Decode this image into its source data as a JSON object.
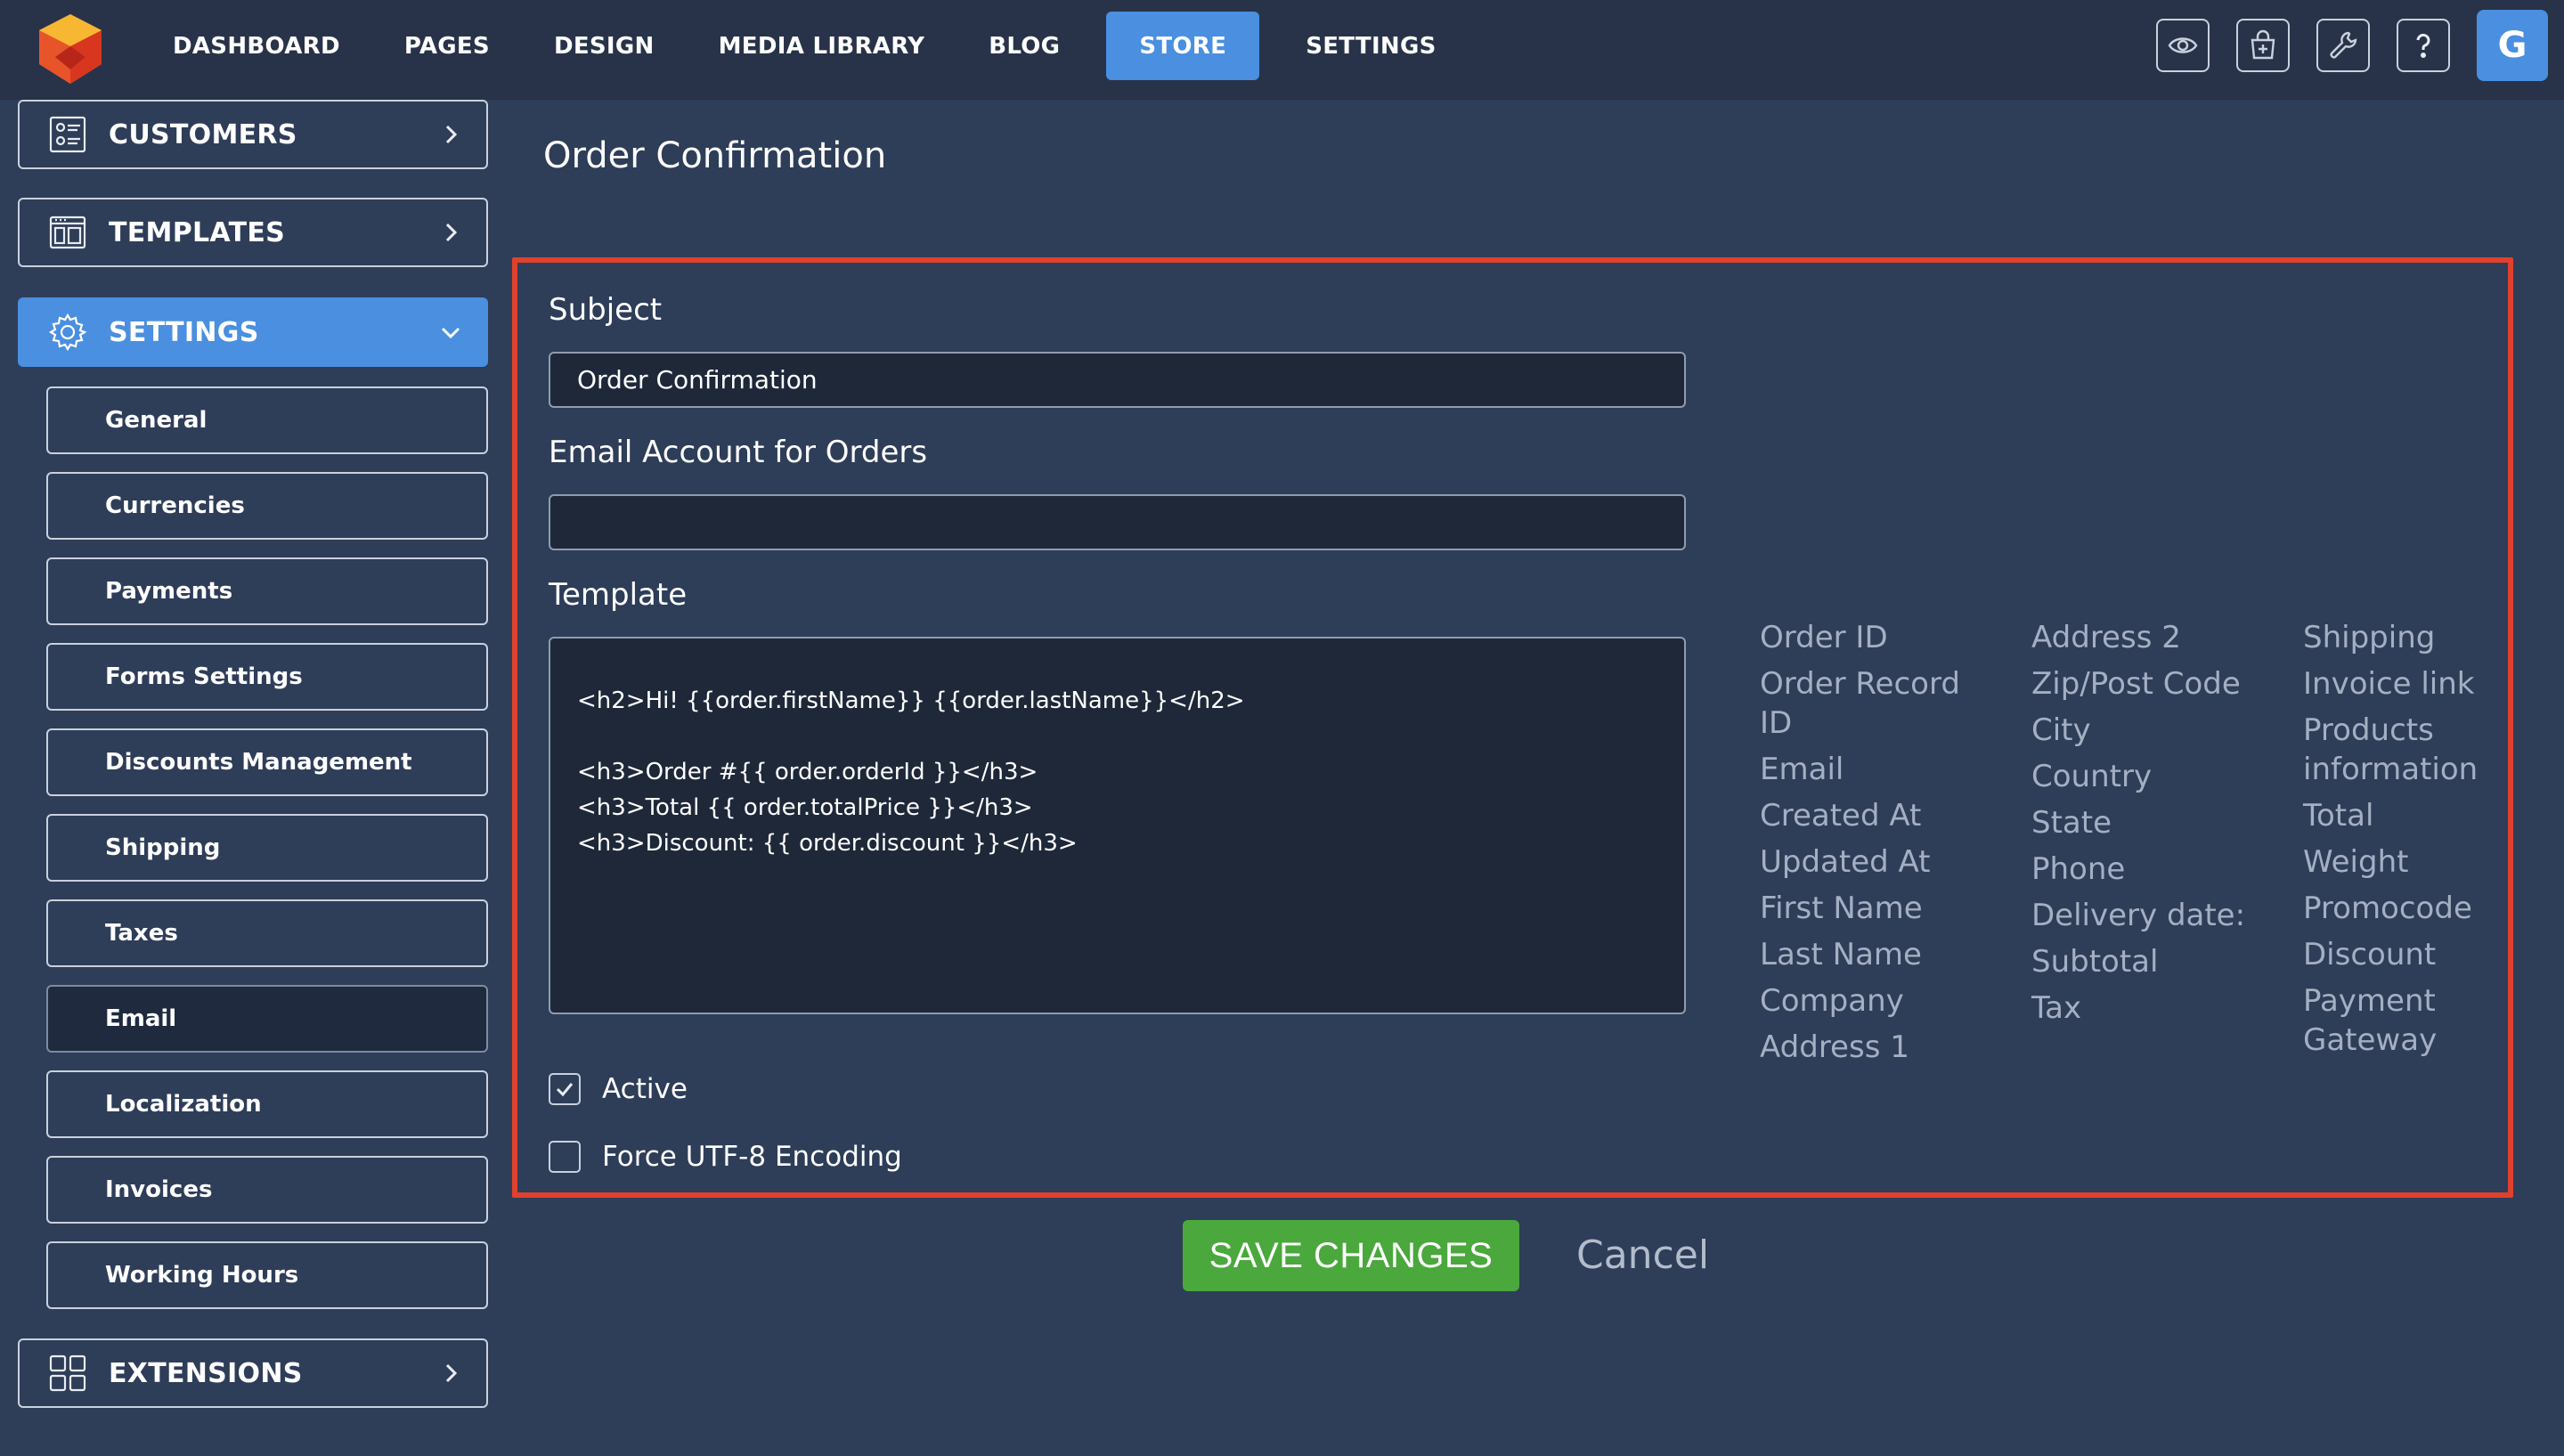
{
  "nav": {
    "items": [
      {
        "label": "DASHBOARD"
      },
      {
        "label": "PAGES"
      },
      {
        "label": "DESIGN"
      },
      {
        "label": "MEDIA LIBRARY"
      },
      {
        "label": "BLOG"
      },
      {
        "label": "STORE"
      },
      {
        "label": "SETTINGS"
      }
    ],
    "active": "STORE",
    "icons": [
      "eye-icon",
      "store-add-icon",
      "wrench-icon",
      "help-icon"
    ],
    "avatar_letter": "G"
  },
  "sidebar": {
    "customers_label": "CUSTOMERS",
    "templates_label": "TEMPLATES",
    "settings_label": "SETTINGS",
    "extensions_label": "EXTENSIONS",
    "sub_items": [
      {
        "label": "General"
      },
      {
        "label": "Currencies"
      },
      {
        "label": "Payments"
      },
      {
        "label": "Forms Settings"
      },
      {
        "label": "Discounts Management"
      },
      {
        "label": "Shipping"
      },
      {
        "label": "Taxes"
      },
      {
        "label": "Email"
      },
      {
        "label": "Localization"
      },
      {
        "label": "Invoices"
      },
      {
        "label": "Working Hours"
      }
    ],
    "current": "Email"
  },
  "page": {
    "title": "Order Confirmation"
  },
  "form": {
    "subject_label": "Subject",
    "subject_value": "Order Confirmation",
    "email_account_label": "Email Account for Orders",
    "email_account_value": "",
    "template_label": "Template",
    "template_value": "<h2>Hi! {{order.firstName}} {{order.lastName}}</h2>\n\n<h3>Order #{{ order.orderId }}</h3>\n<h3>Total {{ order.totalPrice }}</h3>\n<h3>Discount: {{ order.discount }}</h3>",
    "active_label": "Active",
    "active_checked": true,
    "utf8_label": "Force UTF-8 Encoding",
    "utf8_checked": false
  },
  "variables": {
    "col1": [
      "Order ID",
      "Order Record ID",
      "Email",
      "Created At",
      "Updated At",
      "First Name",
      "Last Name",
      "Company",
      "Address 1"
    ],
    "col2": [
      "Address 2",
      "Zip/Post Code",
      "City",
      "Country",
      "State",
      "Phone",
      "Delivery date:",
      "Subtotal",
      "Tax"
    ],
    "col3": [
      "Shipping",
      "Invoice link",
      "Products information",
      "Total",
      "Weight",
      "Promocode",
      "Discount",
      "Payment Gateway"
    ]
  },
  "actions": {
    "save_label": "SAVE CHANGES",
    "cancel_label": "Cancel"
  },
  "colors": {
    "background": "#2e3d58",
    "topbar": "#283349",
    "accent": "#4a8fe0",
    "save": "#4aa83c",
    "highlight_border": "#e0412e"
  }
}
